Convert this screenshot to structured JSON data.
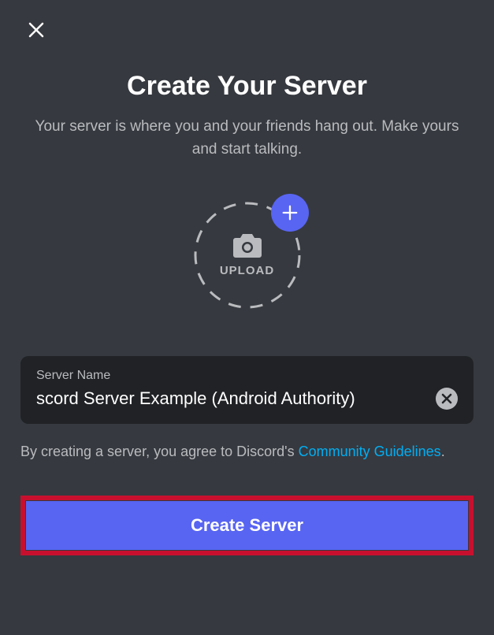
{
  "header": {
    "title": "Create Your Server",
    "subtitle": "Your server is where you and your friends hang out. Make yours and start talking."
  },
  "upload": {
    "label": "UPLOAD"
  },
  "input": {
    "label": "Server Name",
    "value": "scord Server Example (Android Authority)"
  },
  "terms": {
    "prefix": "By creating a server, you agree to Discord's ",
    "link": "Community Guidelines",
    "suffix": "."
  },
  "button": {
    "create": "Create Server"
  }
}
